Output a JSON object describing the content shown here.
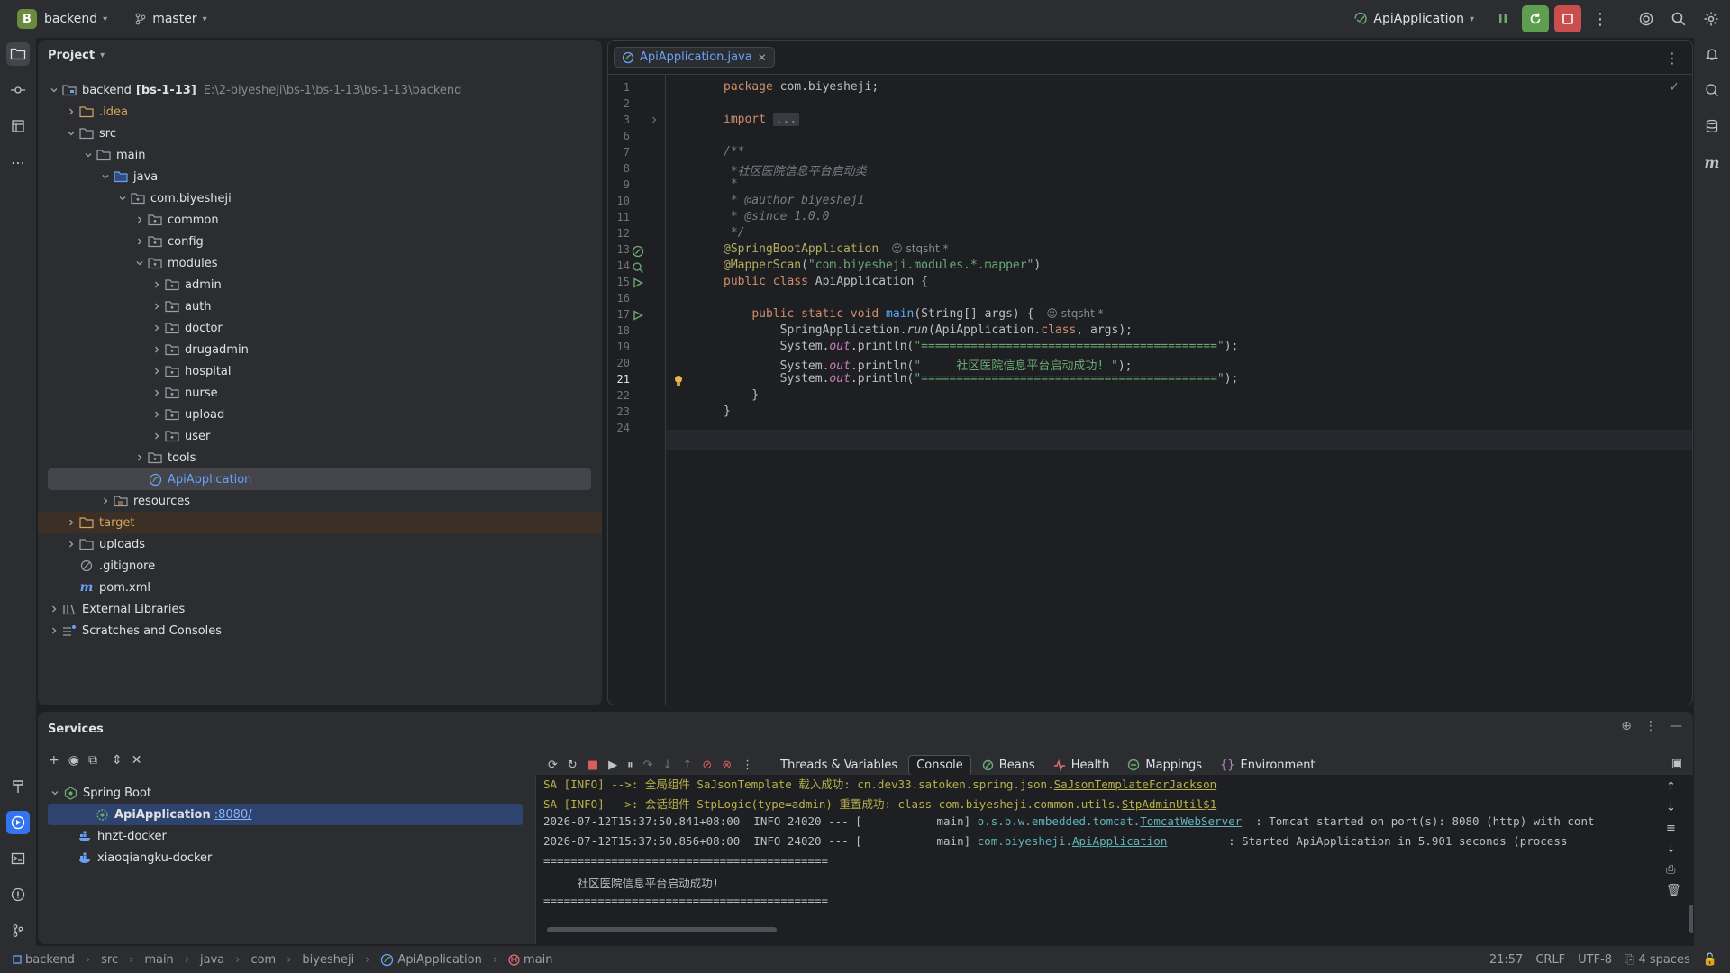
{
  "topbar": {
    "project_letter": "B",
    "project_name": "backend",
    "branch": "master",
    "run_config": "ApiApplication"
  },
  "project_panel": {
    "title": "Project",
    "tree": [
      {
        "label": "backend",
        "bold": "[bs-1-13]",
        "path": "E:\\2-biyesheji\\bs-1\\bs-1-13\\bs-1-13\\backend",
        "depth": 0,
        "expanded": true,
        "icon": "module-folder-icon"
      },
      {
        "label": ".idea",
        "depth": 1,
        "expanded": false,
        "icon": "folder-icon",
        "color": "#d7a35b"
      },
      {
        "label": "src",
        "depth": 1,
        "expanded": true,
        "icon": "folder-icon"
      },
      {
        "label": "main",
        "depth": 2,
        "expanded": true,
        "icon": "folder-icon"
      },
      {
        "label": "java",
        "depth": 3,
        "expanded": true,
        "icon": "source-folder-icon"
      },
      {
        "label": "com.biyesheji",
        "depth": 4,
        "expanded": true,
        "icon": "package-icon"
      },
      {
        "label": "common",
        "depth": 5,
        "expanded": false,
        "icon": "package-icon"
      },
      {
        "label": "config",
        "depth": 5,
        "expanded": false,
        "icon": "package-icon"
      },
      {
        "label": "modules",
        "depth": 5,
        "expanded": true,
        "icon": "package-icon"
      },
      {
        "label": "admin",
        "depth": 6,
        "expanded": false,
        "icon": "package-icon"
      },
      {
        "label": "auth",
        "depth": 6,
        "expanded": false,
        "icon": "package-icon"
      },
      {
        "label": "doctor",
        "depth": 6,
        "expanded": false,
        "icon": "package-icon"
      },
      {
        "label": "drugadmin",
        "depth": 6,
        "expanded": false,
        "icon": "package-icon"
      },
      {
        "label": "hospital",
        "depth": 6,
        "expanded": false,
        "icon": "package-icon"
      },
      {
        "label": "nurse",
        "depth": 6,
        "expanded": false,
        "icon": "package-icon"
      },
      {
        "label": "upload",
        "depth": 6,
        "expanded": false,
        "icon": "package-icon"
      },
      {
        "label": "user",
        "depth": 6,
        "expanded": false,
        "icon": "package-icon"
      },
      {
        "label": "tools",
        "depth": 5,
        "expanded": false,
        "icon": "package-icon"
      },
      {
        "label": "ApiApplication",
        "depth": 5,
        "leaf": true,
        "icon": "spring-class-icon",
        "selected": true,
        "color": "#6aa1f7"
      },
      {
        "label": "resources",
        "depth": 3,
        "expanded": false,
        "icon": "resources-folder-icon"
      },
      {
        "label": "target",
        "depth": 1,
        "expanded": false,
        "icon": "excluded-folder-icon",
        "color": "#d7a35b",
        "excluded": true
      },
      {
        "label": "uploads",
        "depth": 1,
        "expanded": false,
        "icon": "folder-icon"
      },
      {
        "label": ".gitignore",
        "depth": 1,
        "leaf": true,
        "icon": "ignore-file-icon"
      },
      {
        "label": "pom.xml",
        "depth": 1,
        "leaf": true,
        "icon": "maven-icon"
      },
      {
        "label": "External Libraries",
        "depth": 0,
        "expanded": false,
        "icon": "libraries-icon"
      },
      {
        "label": "Scratches and Consoles",
        "depth": 0,
        "expanded": false,
        "icon": "scratches-icon"
      }
    ]
  },
  "editor": {
    "tab_label": "ApiApplication.java",
    "line_numbers": [
      "1",
      "2",
      "3",
      "6",
      "7",
      "8",
      "9",
      "10",
      "11",
      "12",
      "13",
      "14",
      "15",
      "16",
      "17",
      "18",
      "19",
      "20",
      "21",
      "22",
      "23",
      "24"
    ],
    "current_line": "21",
    "code": {
      "l1": "package com.biyesheji;",
      "l3_kw": "import",
      "l3_fold": "...",
      "l7": "/**",
      "l8": " *社区医院信息平台启动类",
      "l9": " *",
      "l10_a": " * ",
      "l10_tag": "@author",
      "l10_b": " biyesheji",
      "l11_a": " * ",
      "l11_tag": "@since",
      "l11_b": " 1.0.0",
      "l12": " */",
      "l13": "@SpringBootApplication",
      "l13_hint": "stqsht *",
      "l14_ann": "@MapperScan",
      "l14_str": "\"com.biyesheji.modules.*.mapper\"",
      "l15_kw": "public class",
      "l15_rest": " ApiApplication {",
      "l17_kw": "public static void",
      "l17_fn": "main",
      "l17_rest": "(String[] args) {",
      "l17_hint": "stqsht *",
      "l18_a": "SpringApplication.",
      "l18_fn": "run",
      "l18_b": "(ApiApplication.",
      "l18_kw": "class",
      "l18_c": ", args);",
      "println_a": "System.",
      "println_out": "out",
      "println_b": ".println(",
      "l19_str": "\"==========================================\"",
      "l20_str": "\"     社区医院信息平台启动成功! \"",
      "l21_str": "\"==========================================\"",
      "println_end": ");",
      "l22": "    }",
      "l23": "}"
    }
  },
  "services": {
    "title": "Services",
    "tree": [
      {
        "label": "Spring Boot",
        "icon": "spring-boot-icon",
        "depth": 0
      },
      {
        "label": "ApiApplication",
        "port": ":8080/",
        "icon": "spring-run-icon",
        "depth": 1,
        "selected": true
      },
      {
        "label": "hnzt-docker",
        "icon": "docker-icon",
        "depth": 0
      },
      {
        "label": "xiaoqiangku-docker",
        "icon": "docker-icon",
        "depth": 0
      }
    ],
    "console_tabs": [
      {
        "label": "Threads & Variables",
        "icon": ""
      },
      {
        "label": "Console",
        "icon": "",
        "active": true
      },
      {
        "label": "Beans",
        "icon": "beans-icon"
      },
      {
        "label": "Health",
        "icon": "health-icon"
      },
      {
        "label": "Mappings",
        "icon": "mappings-icon"
      },
      {
        "label": "Environment",
        "icon": "environment-icon"
      }
    ],
    "console": {
      "line1_a": "SA [INFO] -->: 全局组件 SaJsonTemplate 载入成功: cn.dev33.satoken.spring.json.",
      "line1_link": "SaJsonTemplateForJackson",
      "line2_a": "SA [INFO] -->: 会话组件 StpLogic(type=admin) 重置成功: class com.biyesheji.common.utils.",
      "line2_link": "StpAdminUtil$1",
      "line3_a": "2026-07-12T15:37:50.841+08:00  INFO 24020 --- [           main] ",
      "line3_pkg": "o.s.b.w.embedded.tomcat.",
      "line3_link": "TomcatWebServer",
      "line3_b": "  : Tomcat started on port(s): 8080 (http) with cont",
      "line4_a": "2026-07-12T15:37:50.856+08:00  INFO 24020 --- [           main] ",
      "line4_pkg": "com.biyesheji.",
      "line4_link": "ApiApplication",
      "line4_b": "         : Started ApiApplication in 5.901 seconds (process",
      "line5": "==========================================",
      "line6": "     社区医院信息平台启动成功!",
      "line7": "=========================================="
    }
  },
  "statusbar": {
    "breadcrumbs": [
      "backend",
      "src",
      "main",
      "java",
      "com",
      "biyesheji",
      "ApiApplication",
      "main"
    ],
    "position": "21:57",
    "line_sep": "CRLF",
    "encoding": "UTF-8",
    "indent": "4 spaces"
  },
  "colors": {
    "accent": "#3574f0",
    "run_green": "#5f9e4e",
    "stop_red": "#c94f4f",
    "keyword": "#cf8e6d",
    "string": "#6aab73",
    "annotation": "#b3ae60"
  }
}
